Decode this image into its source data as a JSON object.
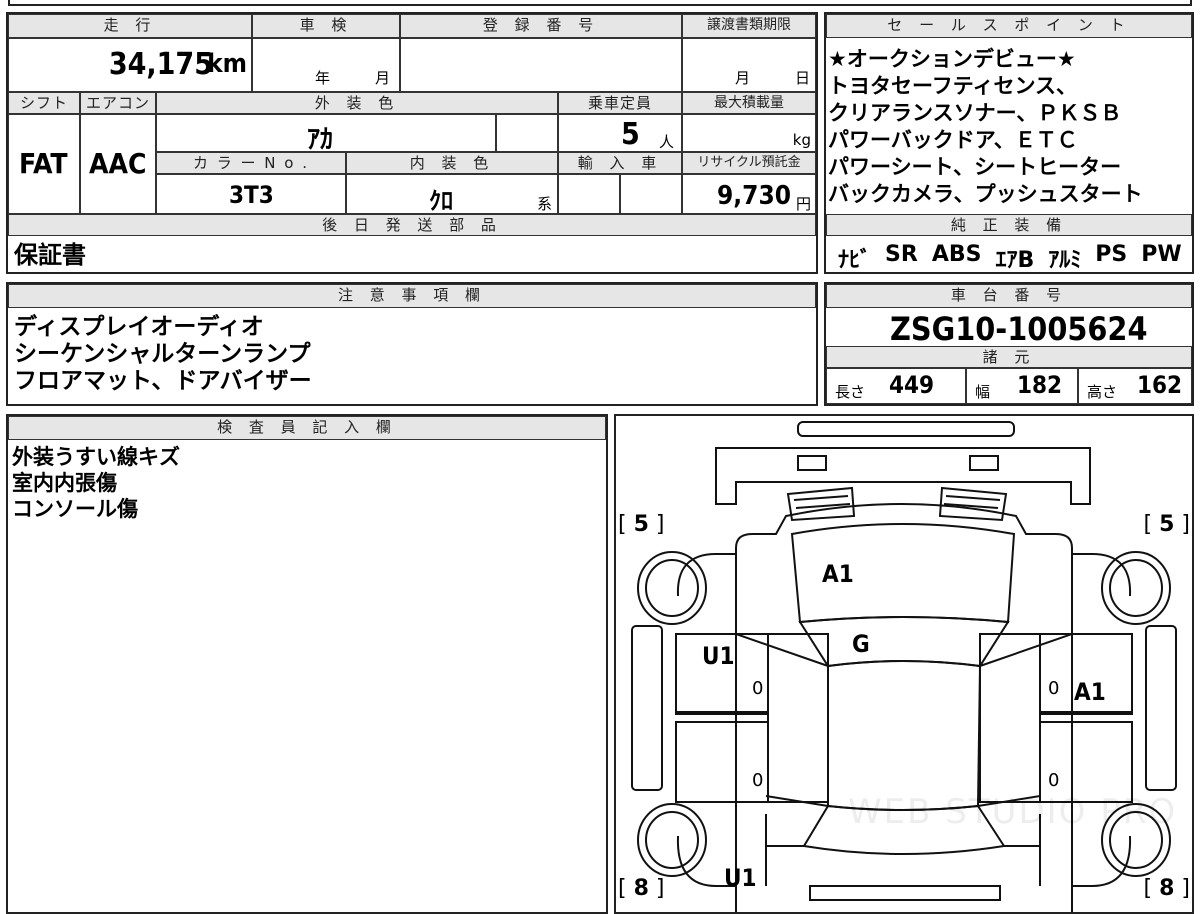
{
  "top": {
    "mileage_label": "走 行",
    "mileage_value": "34,175",
    "mileage_unit": "km",
    "shaken_label": "車 検",
    "shaken_year": "年",
    "shaken_month": "月",
    "reg_label": "登 録 番 号",
    "transfer_label": "譲渡書類期限",
    "transfer_month": "月",
    "transfer_day": "日",
    "shift_label": "シフト",
    "shift_value": "FAT",
    "ac_label": "エアコン",
    "ac_value": "AAC",
    "color_label": "外 装 色",
    "color_value": "ｱｶ",
    "capacity_label": "乗車定員",
    "capacity_value": "5",
    "capacity_unit": "人",
    "maxload_label": "最大積載量",
    "maxload_unit": "kg",
    "colorno_label": "カ ラ ー N o .",
    "colorno_value": "3T3",
    "interior_label": "内 装 色",
    "interior_value": "ｸﾛ",
    "interior_unit": "系",
    "import_label": "輸 入 車",
    "recycle_label": "リサイクル預託金",
    "recycle_value": "9,730",
    "recycle_unit": "円",
    "later_label": "後 日 発 送 部 品",
    "later_value": "保証書"
  },
  "sales": {
    "label": "セ ー ル ス ポ イ ン ト",
    "lines": [
      "★オークションデビュー★",
      "トヨタセーフティセンス、",
      "クリアランスソナー、ＰＫＳＢ",
      "パワーバックドア、ＥＴＣ",
      "パワーシート、シートヒーター",
      "バックカメラ、プッシュスタート"
    ]
  },
  "equipment": {
    "label": "純 正 装 備",
    "items": [
      "ﾅﾋﾞ",
      "SR",
      "ABS",
      "ｴｱB",
      "ｱﾙﾐ",
      "PS",
      "PW"
    ]
  },
  "notes": {
    "label": "注 意 事 項 欄",
    "lines": [
      "ディスプレイオーディオ",
      "シーケンシャルターンランプ",
      "フロアマット、ドアバイザー"
    ]
  },
  "chassis": {
    "label": "車 台 番 号",
    "value": "ZSG10-1005624",
    "spec_label": "諸 元",
    "length_label": "長さ",
    "length_value": "449",
    "width_label": "幅",
    "width_value": "182",
    "height_label": "高さ",
    "height_value": "162"
  },
  "inspector": {
    "label": "検 査 員 記 入 欄",
    "lines": [
      "外装うすい線キズ",
      "室内内張傷",
      "コンソール傷"
    ]
  },
  "diagram": {
    "tire_fl": "5",
    "tire_fr": "5",
    "tire_rl": "8",
    "tire_rr": "8",
    "hood": "A1",
    "windshield": "G",
    "left_front_door": "U1",
    "right_front_door": "A1",
    "rear_bottom": "U1",
    "zero": "0",
    "watermark": "WEB STUDIO PRO"
  }
}
